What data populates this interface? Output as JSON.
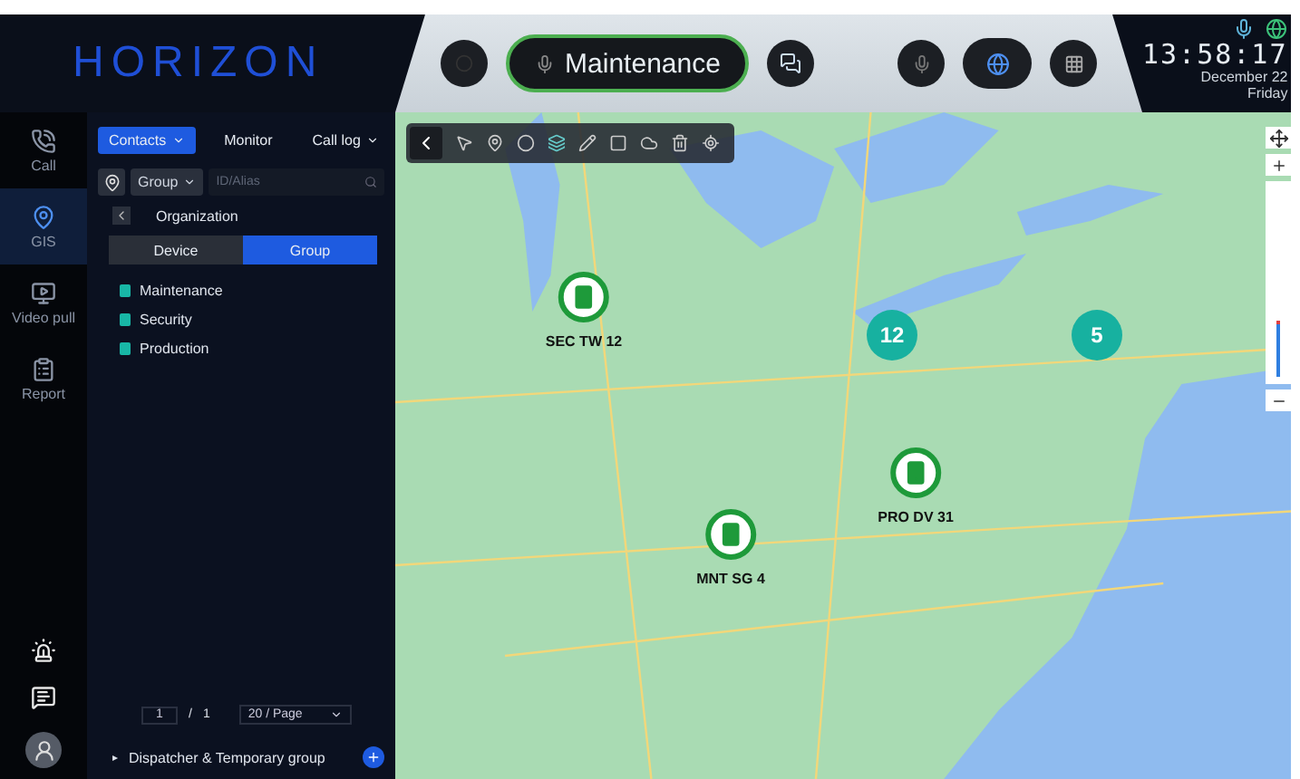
{
  "brand": "HORIZON",
  "rail": [
    {
      "label": "Call",
      "selected": false
    },
    {
      "label": "GIS",
      "selected": true
    },
    {
      "label": "Video pull",
      "selected": false
    },
    {
      "label": "Report",
      "selected": false
    }
  ],
  "panel_tabs": [
    {
      "label": "Contacts",
      "selected": true,
      "dropdown": true
    },
    {
      "label": "Monitor",
      "selected": false,
      "dropdown": false
    },
    {
      "label": "Call log",
      "selected": false,
      "dropdown": true
    }
  ],
  "search": {
    "filter": "Group",
    "placeholder": "ID/Alias"
  },
  "breadcrumb": "Organization",
  "view_toggle": [
    {
      "label": "Device",
      "selected": false
    },
    {
      "label": "Group",
      "selected": true
    }
  ],
  "groups": [
    {
      "name": "Maintenance"
    },
    {
      "name": "Security"
    },
    {
      "name": "Production"
    }
  ],
  "pagination": {
    "page": "1",
    "separator": "/",
    "total": "1",
    "page_size": "20 / Page"
  },
  "footer": {
    "expander": "▸",
    "label": "Dispatcher & Temporary group"
  },
  "call_bar": {
    "group": "Maintenance"
  },
  "clock": {
    "time": "13:58:17",
    "date": "December 22",
    "weekday": "Friday"
  },
  "map": {
    "zoom": {
      "level": 0.3
    }
  },
  "markers": [
    {
      "kind": "device",
      "label": "SEC TW 12"
    },
    {
      "kind": "cluster",
      "label": "12"
    },
    {
      "kind": "cluster",
      "label": "5"
    },
    {
      "kind": "device",
      "label": "PRO DV 31"
    },
    {
      "kind": "device",
      "label": "MNT SG 4"
    }
  ]
}
